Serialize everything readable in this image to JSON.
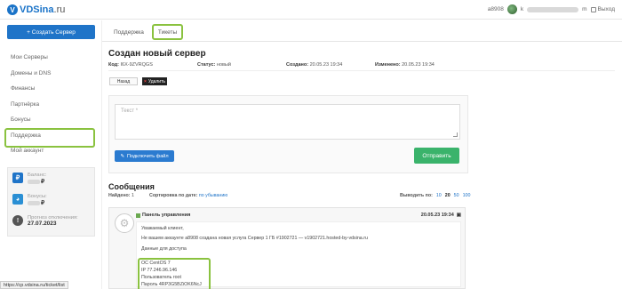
{
  "header": {
    "logo_mark": "V",
    "logo_main": "VDSina",
    "logo_suffix": ".ru",
    "account_id": "a8908",
    "email_start": "k",
    "email_end": "m",
    "logout_label": "Выход"
  },
  "sidebar": {
    "create_button": "+ Создать Сервер",
    "items": [
      {
        "label": "Мои Серверы",
        "active": false
      },
      {
        "label": "Домены и DNS",
        "active": false
      },
      {
        "label": "Финансы",
        "active": false
      },
      {
        "label": "Партнёрка",
        "active": false
      },
      {
        "label": "Бонусы",
        "active": false
      },
      {
        "label": "Поддержка",
        "active": true
      },
      {
        "label": "Мой аккаунт",
        "active": false
      }
    ],
    "balance_label": "Баланс:",
    "balance_currency": "₽",
    "bonus_label": "Бонусы:",
    "bonus_currency": "₽",
    "shutdown_label": "Прогноз отключения:",
    "shutdown_date": "27.07.2023",
    "shutdown_icon": "!"
  },
  "status_url": "https://cp.vdsina.ru/ticket/list",
  "tabs": [
    {
      "label": "Поддержка",
      "active": false
    },
    {
      "label": "Тикеты",
      "active": true
    }
  ],
  "ticket": {
    "title": "Создан новый сервер",
    "code_label": "Код:",
    "code_value": "I6X-9ZVRQGS",
    "status_label": "Статус:",
    "status_value": "новый",
    "created_label": "Создано:",
    "created_value": "20.05.23 19:34",
    "changed_label": "Изменено:",
    "changed_value": "20.05.23 19:34",
    "back_button": "Назад",
    "delete_button": "Удалить"
  },
  "reply": {
    "placeholder": "Текст *",
    "attach_button": "Подключить файл",
    "send_button": "Отправить"
  },
  "messages": {
    "title": "Сообщения",
    "found_label": "Найдено:",
    "found_value": "1",
    "sort_label": "Сортировка по дате:",
    "sort_value": "по убыванию",
    "per_page_label": "Выводить по:",
    "per_page_options": [
      "10",
      "20",
      "50",
      "100"
    ],
    "per_page_current": "20"
  },
  "message": {
    "author": "Панель управления",
    "date": "20.05.23 19:34",
    "lines": [
      "Уважаемый клиент,",
      "Не вашем аккаунте a8908 создана новая услуга Сервер 1 ГБ #1902721 — v1902721.hosted-by-vdsina.ru",
      "Данные для доступа",
      "ОС CentOS 7",
      "IP 77.246.96.146",
      "Пользователь root",
      "Пароль 4RP3G5BZiOK6NcJ"
    ]
  }
}
